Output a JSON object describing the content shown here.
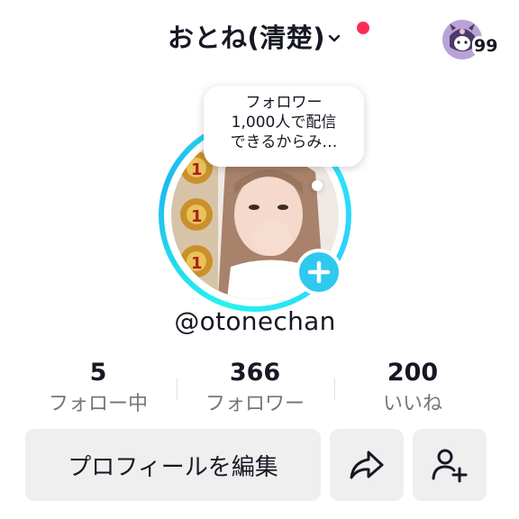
{
  "header": {
    "account_name": "おとね(清楚)",
    "inbox_count": "99"
  },
  "bubble": {
    "lines": [
      "フォロワー",
      "1,000人で配信",
      "できるからみ…"
    ]
  },
  "profile": {
    "username": "@otonechan"
  },
  "stats": [
    {
      "value": "5",
      "label": "フォロー中"
    },
    {
      "value": "366",
      "label": "フォロワー"
    },
    {
      "value": "200",
      "label": "いいね"
    }
  ],
  "actions": {
    "edit_profile_label": "プロフィールを編集"
  },
  "colors": {
    "accent_cyan": "#25f4ee",
    "add_button": "#2fc8ef",
    "notification_dot": "#fe2c55",
    "secondary_text": "#75767b",
    "button_bg": "#efeff0"
  },
  "icons": {
    "chevron": "chevron-down-icon",
    "add": "plus-icon",
    "share": "share-arrow-icon",
    "add_friend": "add-user-icon"
  }
}
